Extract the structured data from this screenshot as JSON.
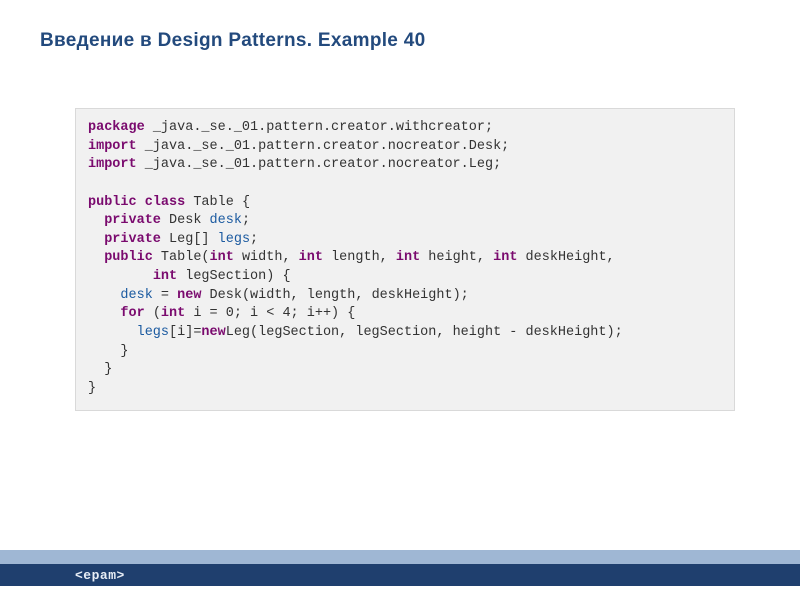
{
  "title": "Введение в Design Patterns. Example 40",
  "code": {
    "l1": {
      "kw": "package",
      "rest": " _java._se._01.pattern.creator.withcreator;"
    },
    "l2": {
      "kw": "import",
      "rest": " _java._se._01.pattern.creator.nocreator.Desk;"
    },
    "l3": {
      "kw": "import",
      "rest": " _java._se._01.pattern.creator.nocreator.Leg;"
    },
    "l5": {
      "kw1": "public",
      "kw2": "class",
      "rest": " Table {"
    },
    "l6": {
      "indent": "  ",
      "kw": "private",
      "type": " Desk ",
      "fld": "desk",
      "rest": ";"
    },
    "l7": {
      "indent": "  ",
      "kw": "private",
      "type": " Leg[] ",
      "fld": "legs",
      "rest": ";"
    },
    "l8": {
      "indent": "  ",
      "kw1": "public",
      "name": " Table(",
      "kw2": "int",
      "p1": " width, ",
      "kw3": "int",
      "p2": " length, ",
      "kw4": "int",
      "p3": " height, ",
      "kw5": "int",
      "p4": " deskHeight,"
    },
    "l9": {
      "indent": "        ",
      "kw": "int",
      "rest": " legSection) {"
    },
    "l10": {
      "indent": "    ",
      "fld": "desk",
      "mid": " = ",
      "kw": "new",
      "rest": " Desk(width, length, deskHeight);"
    },
    "l11": {
      "indent": "    ",
      "kw1": "for",
      "open": " (",
      "kw2": "int",
      "rest": " i = 0; i < 4; i++) {"
    },
    "l12": {
      "indent": "      ",
      "fld": "legs",
      "mid": "[i]=",
      "kw": "new",
      "rest": "Leg(legSection, legSection, height - deskHeight);"
    },
    "l13": "    }",
    "l14": "  }",
    "l15": "}"
  },
  "footer": {
    "logo": "<epam>"
  }
}
